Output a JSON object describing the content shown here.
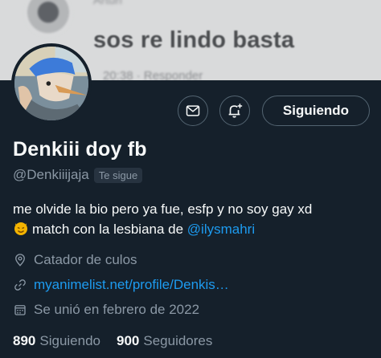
{
  "banner": {
    "author_name": "Arturi",
    "message": "sos re lindo basta",
    "meta": "20:38 · Responder"
  },
  "profile": {
    "display_name": "Denkiii doy fb",
    "handle": "@Denkiiijaja",
    "follows_you_badge": "Te sigue",
    "bio_line1": "me olvide la bio pero ya fue, esfp y no soy gay xd",
    "bio_line2_text": "match con la lesbiana de ",
    "bio_mention": "@ilysmahri",
    "location": "Catador de culos",
    "website": "myanimelist.net/profile/Denkis…",
    "joined": "Se unió en febrero de 2022"
  },
  "actions": {
    "message_icon": "mail-icon",
    "notify_icon": "bell-plus-icon",
    "follow_label": "Siguiendo"
  },
  "stats": {
    "following_count": "890",
    "following_label": "Siguiendo",
    "followers_count": "900",
    "followers_label": "Seguidores"
  },
  "colors": {
    "background": "#15202b",
    "accent": "#1d9bf0",
    "secondary_text": "#8b98a5"
  }
}
